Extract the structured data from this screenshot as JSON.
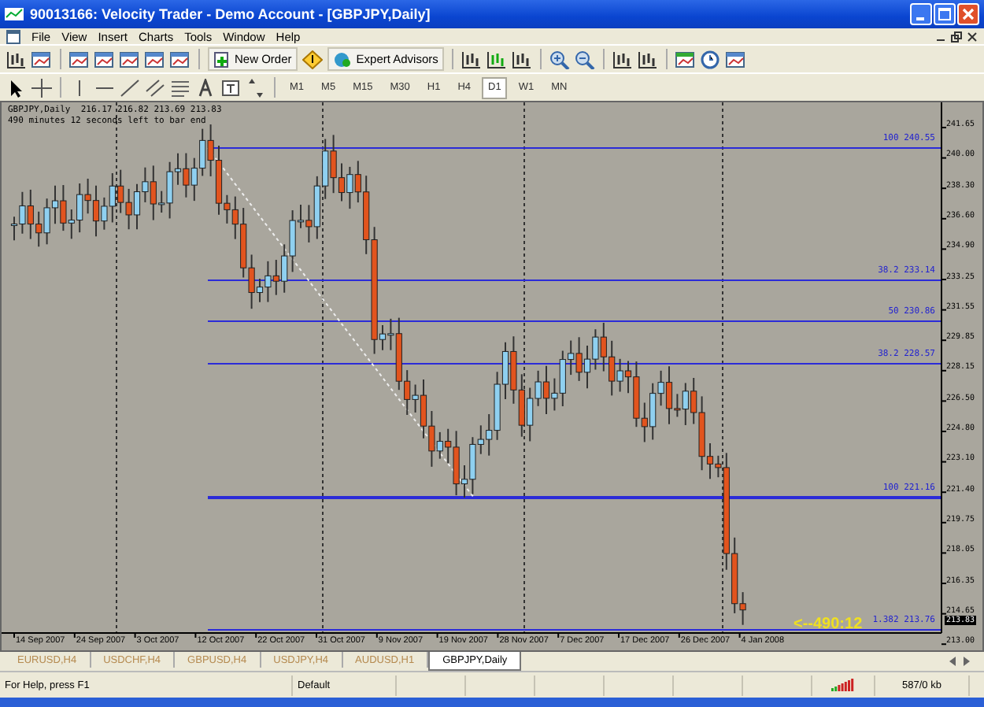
{
  "window": {
    "title": "90013166: Velocity Trader - Demo Account - [GBPJPY,Daily]"
  },
  "menu": [
    "File",
    "View",
    "Insert",
    "Charts",
    "Tools",
    "Window",
    "Help"
  ],
  "toolbar": {
    "buttons": [
      {
        "label": "New Order"
      },
      {
        "label": "Expert Advisors"
      }
    ]
  },
  "timeframes": [
    {
      "label": "M1",
      "selected": false
    },
    {
      "label": "M5",
      "selected": false
    },
    {
      "label": "M15",
      "selected": false
    },
    {
      "label": "M30",
      "selected": false
    },
    {
      "label": "H1",
      "selected": false
    },
    {
      "label": "H4",
      "selected": false
    },
    {
      "label": "D1",
      "selected": true
    },
    {
      "label": "W1",
      "selected": false
    },
    {
      "label": "MN",
      "selected": false
    }
  ],
  "chart": {
    "info": "GBPJPY,Daily  216.17 216.82 213.69 213.83",
    "timer_note": "490 minutes 12 seconds left to bar end",
    "fib_levels": [
      {
        "label": "100 240.55"
      },
      {
        "label": "38.2 233.14"
      },
      {
        "label": "50 230.86"
      },
      {
        "label": "38.2 228.57"
      },
      {
        "label": "100 221.16"
      },
      {
        "label": "1.382 213.76"
      }
    ],
    "price_ticks": [
      "241.65",
      "240.00",
      "238.30",
      "236.60",
      "234.90",
      "233.25",
      "231.55",
      "229.85",
      "228.15",
      "226.50",
      "224.80",
      "223.10",
      "221.40",
      "219.75",
      "218.05",
      "216.35",
      "214.65",
      "213.00"
    ],
    "current_price": "213.83",
    "countdown": "<--490:12",
    "dates": [
      "14 Sep 2007",
      "24 Sep 2007",
      "3 Oct 2007",
      "12 Oct 2007",
      "22 Oct 2007",
      "31 Oct 2007",
      "9 Nov 2007",
      "19 Nov 2007",
      "28 Nov 2007",
      "7 Dec 2007",
      "17 Dec 2007",
      "26 Dec 2007",
      "4 Jan 2008"
    ]
  },
  "tabs": [
    {
      "label": "EURUSD,H4",
      "selected": false
    },
    {
      "label": "USDCHF,H4",
      "selected": false
    },
    {
      "label": "GBPUSD,H4",
      "selected": false
    },
    {
      "label": "USDJPY,H4",
      "selected": false
    },
    {
      "label": "AUDUSD,H1",
      "selected": false
    },
    {
      "label": "GBPJPY,Daily",
      "selected": true
    }
  ],
  "status_bar": {
    "help": "For Help, press F1",
    "profile": "Default",
    "traffic": "587/0 kb"
  }
}
